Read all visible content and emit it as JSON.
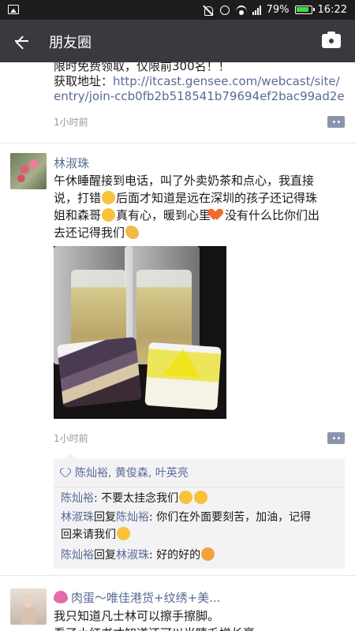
{
  "status_bar": {
    "battery": "79%",
    "time": "16:22"
  },
  "app_bar": {
    "title": "朋友圈"
  },
  "post1": {
    "line1": "限时免费领取，仅限前300名！！",
    "line2_prefix": "获取地址：",
    "line2_link": "http://itcast.gensee.com/webcast/site/",
    "line3_link": "entry/join-ccb0fb2b518541b79694ef2bac99ad2e",
    "time": "1小时前"
  },
  "post2": {
    "author": "林淑珠",
    "text_line1": "午休睡醒接到电话，叫了外卖奶茶和点心，我直接",
    "text_line2a": "说，打错",
    "text_line2b": "后面才知道是远在深圳的孩子还记得珠",
    "text_line3a": "姐和森哥",
    "text_line3b": "真有心，暖到心里",
    "text_line3c": "没有什么比你们出",
    "text_line4": "去还记得我们",
    "time": "1小时前",
    "likes": "陈灿裕, 黄俊森, 叶英亮",
    "comments": [
      {
        "author": "陈灿裕",
        "reply_to": "",
        "text": "不要太挂念我们"
      },
      {
        "author": "林淑珠",
        "reply_word": "回复",
        "reply_to": "陈灿裕",
        "text": "你们在外面要刻苦，加油，记得",
        "text2": "回来请我们"
      },
      {
        "author": "陈灿裕",
        "reply_word": "回复",
        "reply_to": "林淑珠",
        "text": "好的好的"
      }
    ]
  },
  "post3": {
    "author": "肉蛋～唯佳港货+纹绣+美...",
    "text_line1": "我只知道凡士林可以擦手擦脚。",
    "text_line2": "看了小红书才知道还可以当睫毛增长膏"
  },
  "icons": {
    "back": "arrow-left-icon",
    "camera": "camera-icon",
    "more": "comment-more-icon",
    "like": "heart-outline-icon"
  },
  "colors": {
    "appbar": "#393a3f",
    "link": "#576b95",
    "comment_bg": "#f3f3f5"
  }
}
